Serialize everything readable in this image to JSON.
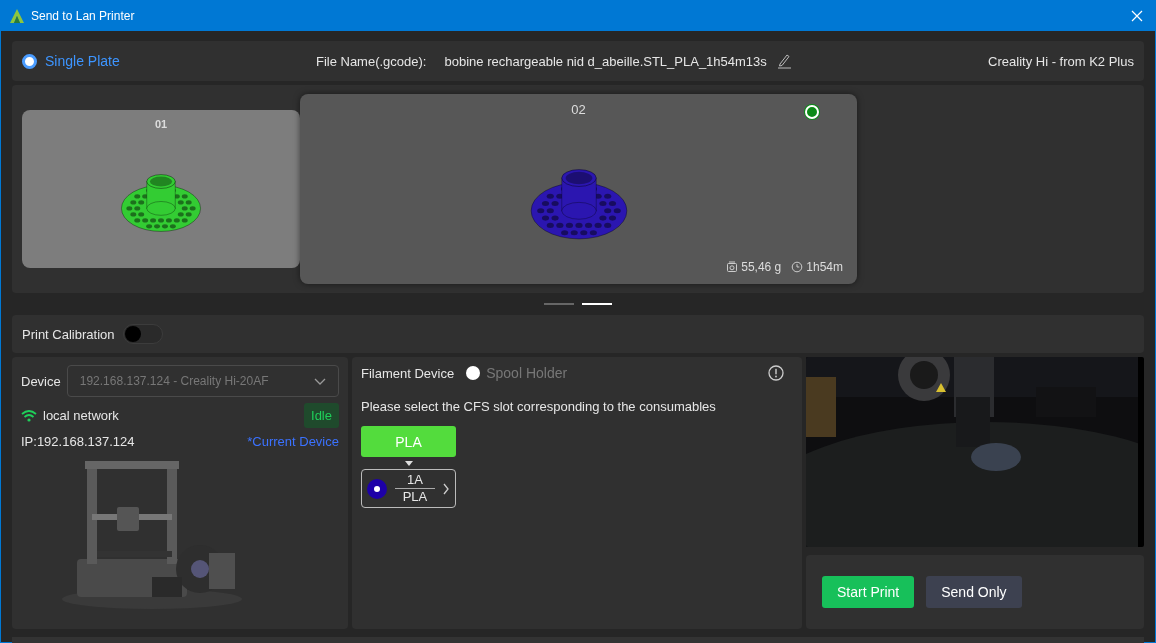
{
  "window": {
    "title": "Send to Lan Printer"
  },
  "plate_mode": {
    "label": "Single Plate",
    "selected": true
  },
  "file_name": {
    "label": "File Name(.gcode):",
    "value": "bobine rechargeable nid d_abeille.STL_PLA_1h54m13s"
  },
  "printer_preset": "Creality Hi - from K2 Plus",
  "plates": [
    {
      "number": "01",
      "selected": false,
      "color": "#33cc33"
    },
    {
      "number": "02",
      "selected": true,
      "color": "#2b16b0",
      "weight": "55,46 g",
      "time": "1h54m"
    }
  ],
  "pager": [
    {
      "selected": false
    },
    {
      "selected": true
    }
  ],
  "print_calibration": {
    "label": "Print Calibration",
    "on": false
  },
  "device": {
    "label": "Device",
    "value": "192.168.137.124 - Creality Hi-20AF",
    "network": "local network",
    "status": "Idle",
    "ip": "IP:192.168.137.124",
    "current": "*Current Device"
  },
  "filament": {
    "label": "Filament Device",
    "spool_holder": {
      "label": "Spool Holder",
      "selected": false
    },
    "hint": "Please select the CFS slot corresponding to the consumables",
    "mappings": [
      {
        "material": "PLA",
        "slot": "1A",
        "slot_material": "PLA",
        "color": "#1d00a8"
      }
    ]
  },
  "buttons": [
    {
      "label": "Start Print",
      "kind": "primary"
    },
    {
      "label": "Send Only",
      "kind": "secondary"
    }
  ]
}
